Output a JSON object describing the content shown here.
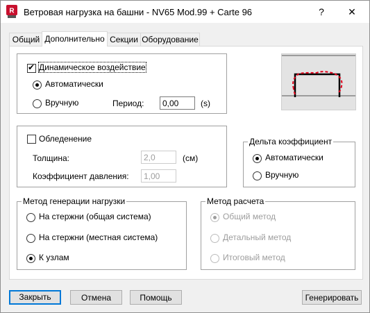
{
  "window": {
    "title": "Ветровая нагрузка на башни - NV65 Mod.99 + Carte 96",
    "help_glyph": "?",
    "close_glyph": "✕"
  },
  "tabs": [
    {
      "label": "Общий",
      "active": false
    },
    {
      "label": "Дополнительно",
      "active": true
    },
    {
      "label": "Секции",
      "active": false
    },
    {
      "label": "Оборудование",
      "active": false
    }
  ],
  "dynamic": {
    "label": "Динамическое воздействие",
    "checked": true,
    "auto_label": "Автоматически",
    "manual_label": "Вручную",
    "period_label": "Период:",
    "period_value": "0,00",
    "period_unit": "(s)"
  },
  "icing": {
    "label": "Обледенение",
    "checked": false,
    "thickness_label": "Толщина:",
    "thickness_value": "2,0",
    "thickness_unit": "(см)",
    "pressure_label": "Коэффициент давления:",
    "pressure_value": "1,00"
  },
  "delta": {
    "legend": "Дельта коэффициент",
    "auto_label": "Автоматически",
    "manual_label": "Вручную"
  },
  "generation": {
    "legend": "Метод генерации нагрузки",
    "options": [
      "На стержни (общая система)",
      "На стержни (местная система)",
      "К узлам"
    ]
  },
  "calc": {
    "legend": "Метод расчета",
    "options": [
      "Общий метод",
      "Детальный метод",
      "Итоговый метод"
    ]
  },
  "buttons": {
    "close": "Закрыть",
    "cancel": "Отмена",
    "help": "Помощь",
    "generate": "Генерировать"
  },
  "colors": {
    "accent": "#0078d7",
    "preview_dash": "#e0001b"
  }
}
